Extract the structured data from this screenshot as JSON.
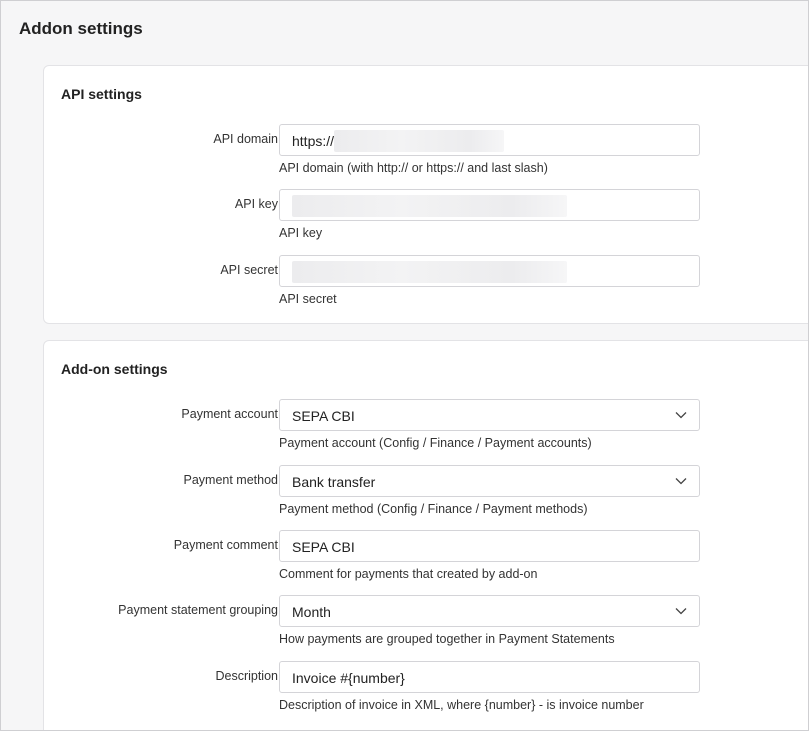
{
  "page": {
    "title": "Addon settings"
  },
  "api_settings": {
    "title": "API settings",
    "fields": [
      {
        "label": "API domain",
        "value": "https://",
        "help": "API domain (with http:// or https:// and last slash)"
      },
      {
        "label": "API key",
        "value": "",
        "help": "API key"
      },
      {
        "label": "API secret",
        "value": "",
        "help": "API secret"
      }
    ]
  },
  "addon_settings": {
    "title": "Add-on settings",
    "fields": [
      {
        "label": "Payment account",
        "value": "SEPA CBI",
        "type": "select",
        "help": "Payment account (Config / Finance / Payment accounts)"
      },
      {
        "label": "Payment method",
        "value": "Bank transfer",
        "type": "select",
        "help": "Payment method (Config / Finance / Payment methods)"
      },
      {
        "label": "Payment comment",
        "value": "SEPA CBI",
        "type": "text",
        "help": "Comment for payments that created by add-on"
      },
      {
        "label": "Payment statement grouping",
        "value": "Month",
        "type": "select",
        "help": "How payments are grouped together in Payment Statements"
      },
      {
        "label": "Description",
        "value": "Invoice #{number}",
        "type": "text",
        "help": "Description of invoice in XML, where {number} - is invoice number"
      }
    ]
  },
  "icons": {
    "select_arrow": "chevron-down-icon"
  }
}
